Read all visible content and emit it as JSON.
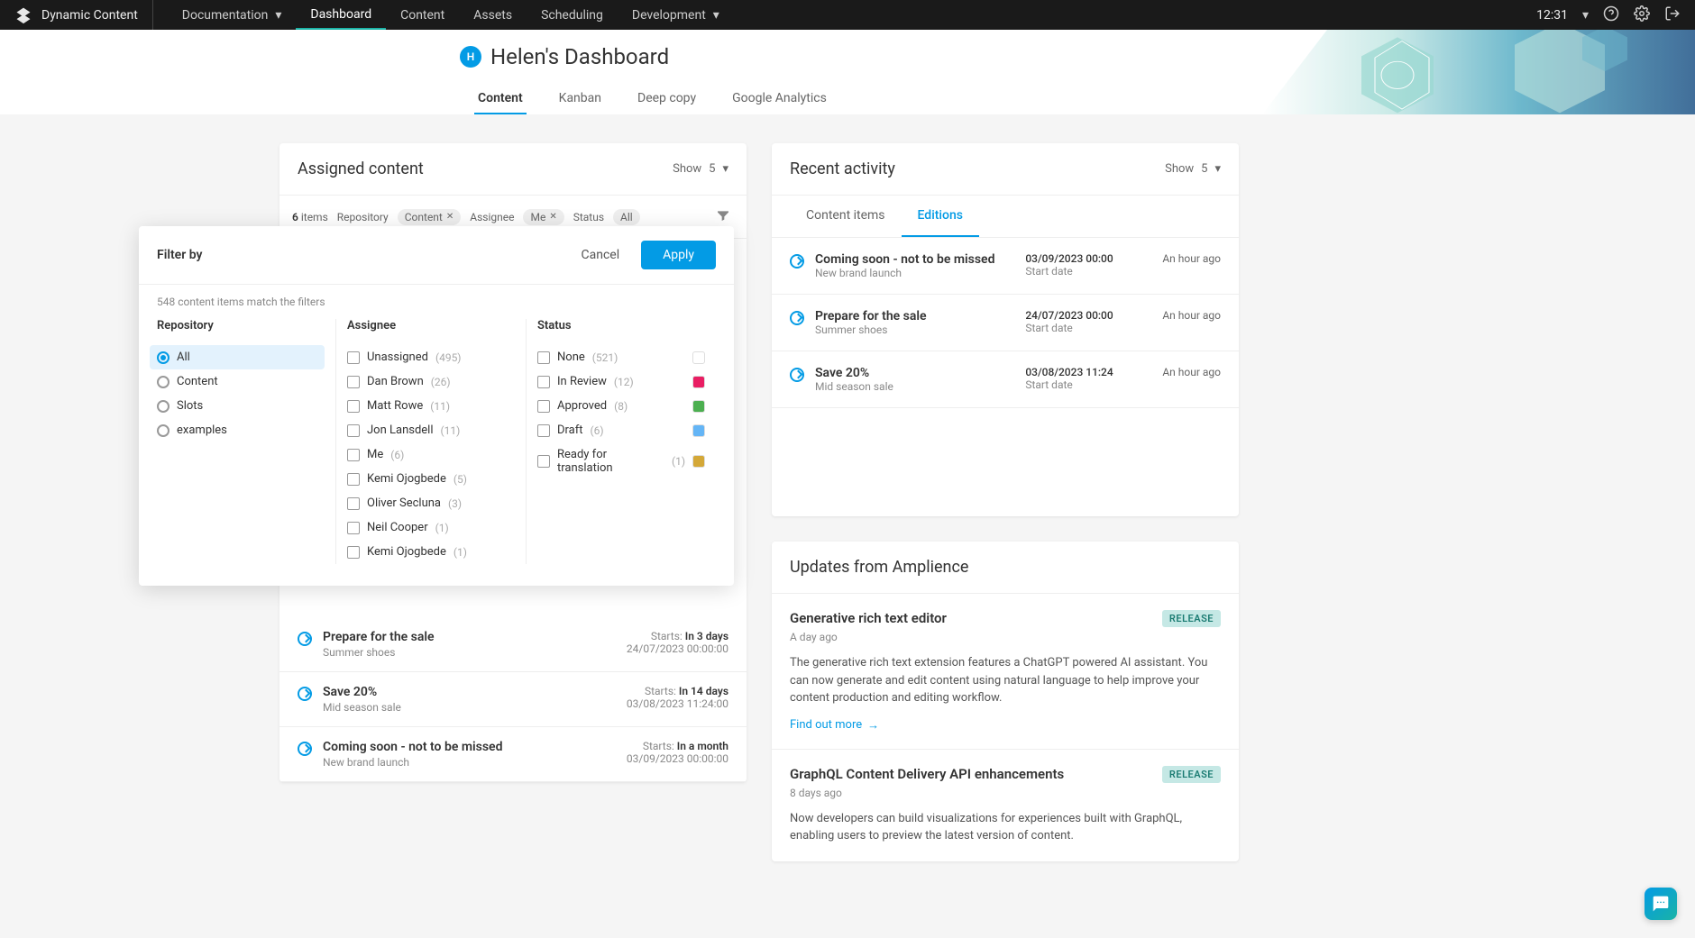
{
  "topbar": {
    "brand": "Dynamic Content",
    "items": [
      "Documentation",
      "Dashboard",
      "Content",
      "Assets",
      "Scheduling",
      "Development"
    ],
    "activeIndex": 1,
    "time": "12:31"
  },
  "header": {
    "avatarInitial": "H",
    "title": "Helen's Dashboard",
    "tabs": [
      "Content",
      "Kanban",
      "Deep copy",
      "Google Analytics"
    ],
    "activeTab": 0
  },
  "assigned": {
    "title": "Assigned content",
    "showLabel": "Show",
    "showValue": "5",
    "count": "6",
    "countLabel": "items",
    "repoLabel": "Repository",
    "repoChip": "Content",
    "assigneeLabel": "Assignee",
    "assigneeChip": "Me",
    "statusLabel": "Status",
    "statusChip": "All"
  },
  "filter": {
    "title": "Filter by",
    "cancel": "Cancel",
    "apply": "Apply",
    "match": "548 content items match the filters",
    "cols": {
      "repo": {
        "title": "Repository",
        "items": [
          {
            "label": "All",
            "selected": true
          },
          {
            "label": "Content",
            "selected": false
          },
          {
            "label": "Slots",
            "selected": false
          },
          {
            "label": "examples",
            "selected": false
          }
        ]
      },
      "assignee": {
        "title": "Assignee",
        "items": [
          {
            "label": "Unassigned",
            "count": "(495)"
          },
          {
            "label": "Dan Brown",
            "count": "(26)"
          },
          {
            "label": "Matt Rowe",
            "count": "(11)"
          },
          {
            "label": "Jon Lansdell",
            "count": "(11)"
          },
          {
            "label": "Me",
            "count": "(6)"
          },
          {
            "label": "Kemi Ojogbede",
            "count": "(5)"
          },
          {
            "label": "Oliver Secluna",
            "count": "(3)"
          },
          {
            "label": "Neil Cooper",
            "count": "(1)"
          },
          {
            "label": "Kemi Ojogbede",
            "count": "(1)"
          }
        ]
      },
      "status": {
        "title": "Status",
        "items": [
          {
            "label": "None",
            "count": "(521)",
            "color": "#fff"
          },
          {
            "label": "In Review",
            "count": "(12)",
            "color": "#e91e63"
          },
          {
            "label": "Approved",
            "count": "(8)",
            "color": "#4caf50"
          },
          {
            "label": "Draft",
            "count": "(6)",
            "color": "#64b5f6"
          },
          {
            "label": "Ready for translation",
            "count": "(1)",
            "color": "#d4a838"
          }
        ]
      }
    }
  },
  "scheduled": [
    {
      "title": "Prepare for the sale",
      "sub": "Summer shoes",
      "startsLabel": "Starts:",
      "when": "In 3 days",
      "date": "24/07/2023 00:00:00"
    },
    {
      "title": "Save 20%",
      "sub": "Mid season sale",
      "startsLabel": "Starts:",
      "when": "In 14 days",
      "date": "03/08/2023 11:24:00"
    },
    {
      "title": "Coming soon - not to be missed",
      "sub": "New brand launch",
      "startsLabel": "Starts:",
      "when": "In a month",
      "date": "03/09/2023 00:00:00"
    }
  ],
  "recent": {
    "title": "Recent activity",
    "showLabel": "Show",
    "showValue": "5",
    "tabs": [
      "Content items",
      "Editions"
    ],
    "activeTab": 1,
    "items": [
      {
        "title": "Coming soon - not to be missed",
        "sub": "New brand launch",
        "mid": "03/09/2023 00:00",
        "midsub": "Start date",
        "time": "An hour ago"
      },
      {
        "title": "Prepare for the sale",
        "sub": "Summer shoes",
        "mid": "24/07/2023 00:00",
        "midsub": "Start date",
        "time": "An hour ago"
      },
      {
        "title": "Save 20%",
        "sub": "Mid season sale",
        "mid": "03/08/2023 11:24",
        "midsub": "Start date",
        "time": "An hour ago"
      }
    ]
  },
  "updates": {
    "title": "Updates from Amplience",
    "items": [
      {
        "title": "Generative rich text editor",
        "badge": "RELEASE",
        "time": "A day ago",
        "body": "The generative rich text extension features a ChatGPT powered AI assistant. You can now generate and edit content using natural language to help improve your content production and editing workflow.",
        "link": "Find out more"
      },
      {
        "title": "GraphQL Content Delivery API enhancements",
        "badge": "RELEASE",
        "time": "8 days ago",
        "body": "Now developers can build visualizations for experiences built with GraphQL, enabling users to preview the latest version of content."
      }
    ]
  }
}
